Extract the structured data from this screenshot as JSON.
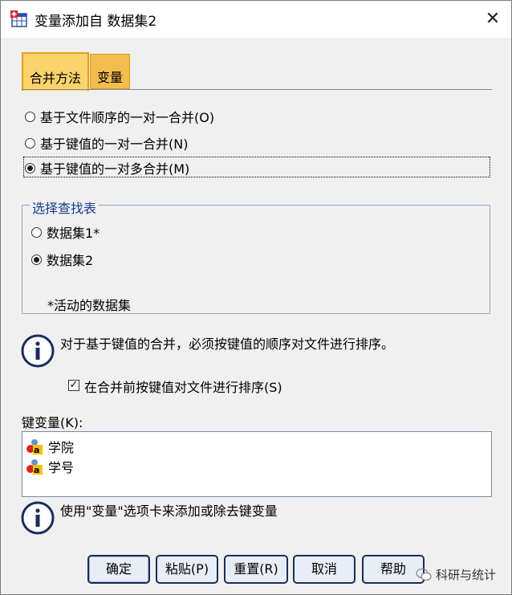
{
  "window": {
    "title": "变量添加自 数据集2",
    "close_label": "✕"
  },
  "tabs": [
    {
      "label": "合并方法",
      "active": true
    },
    {
      "label": "变量",
      "active": false
    }
  ],
  "merge_method": {
    "options": [
      {
        "label": "基于文件顺序的一对一合并(O)",
        "checked": false
      },
      {
        "label": "基于键值的一对一合并(N)",
        "checked": false
      },
      {
        "label": "基于键值的一对多合并(M)",
        "checked": true
      }
    ]
  },
  "lookup": {
    "title": "选择查找表",
    "options": [
      {
        "label": "数据集1*",
        "checked": false
      },
      {
        "label": "数据集2",
        "checked": true
      }
    ],
    "footnote": "*活动的数据集"
  },
  "info1": "对于基于键值的合并，必须按键值的顺序对文件进行排序。",
  "sort_checkbox": {
    "label": "在合并前按键值对文件进行排序(S)",
    "checked": true
  },
  "key_vars": {
    "label": "键变量(K):",
    "items": [
      "学院",
      "学号"
    ]
  },
  "info2": "使用\"变量\"选项卡来添加或除去键变量",
  "buttons": {
    "ok": "确定",
    "paste": "粘贴(P)",
    "reset": "重置(R)",
    "cancel": "取消",
    "help": "帮助"
  },
  "watermark": "科研与统计",
  "colors": {
    "active_tab": "#fbd36b",
    "inactive_tab": "#f2bd4e",
    "group_border": "#8fa8c8",
    "group_title": "#1a3c8c",
    "button_border": "#1a2e5a"
  },
  "icons": {
    "app": "spss-data-icon",
    "info": "info-circle-icon",
    "variable": "nominal-variable-icon"
  }
}
